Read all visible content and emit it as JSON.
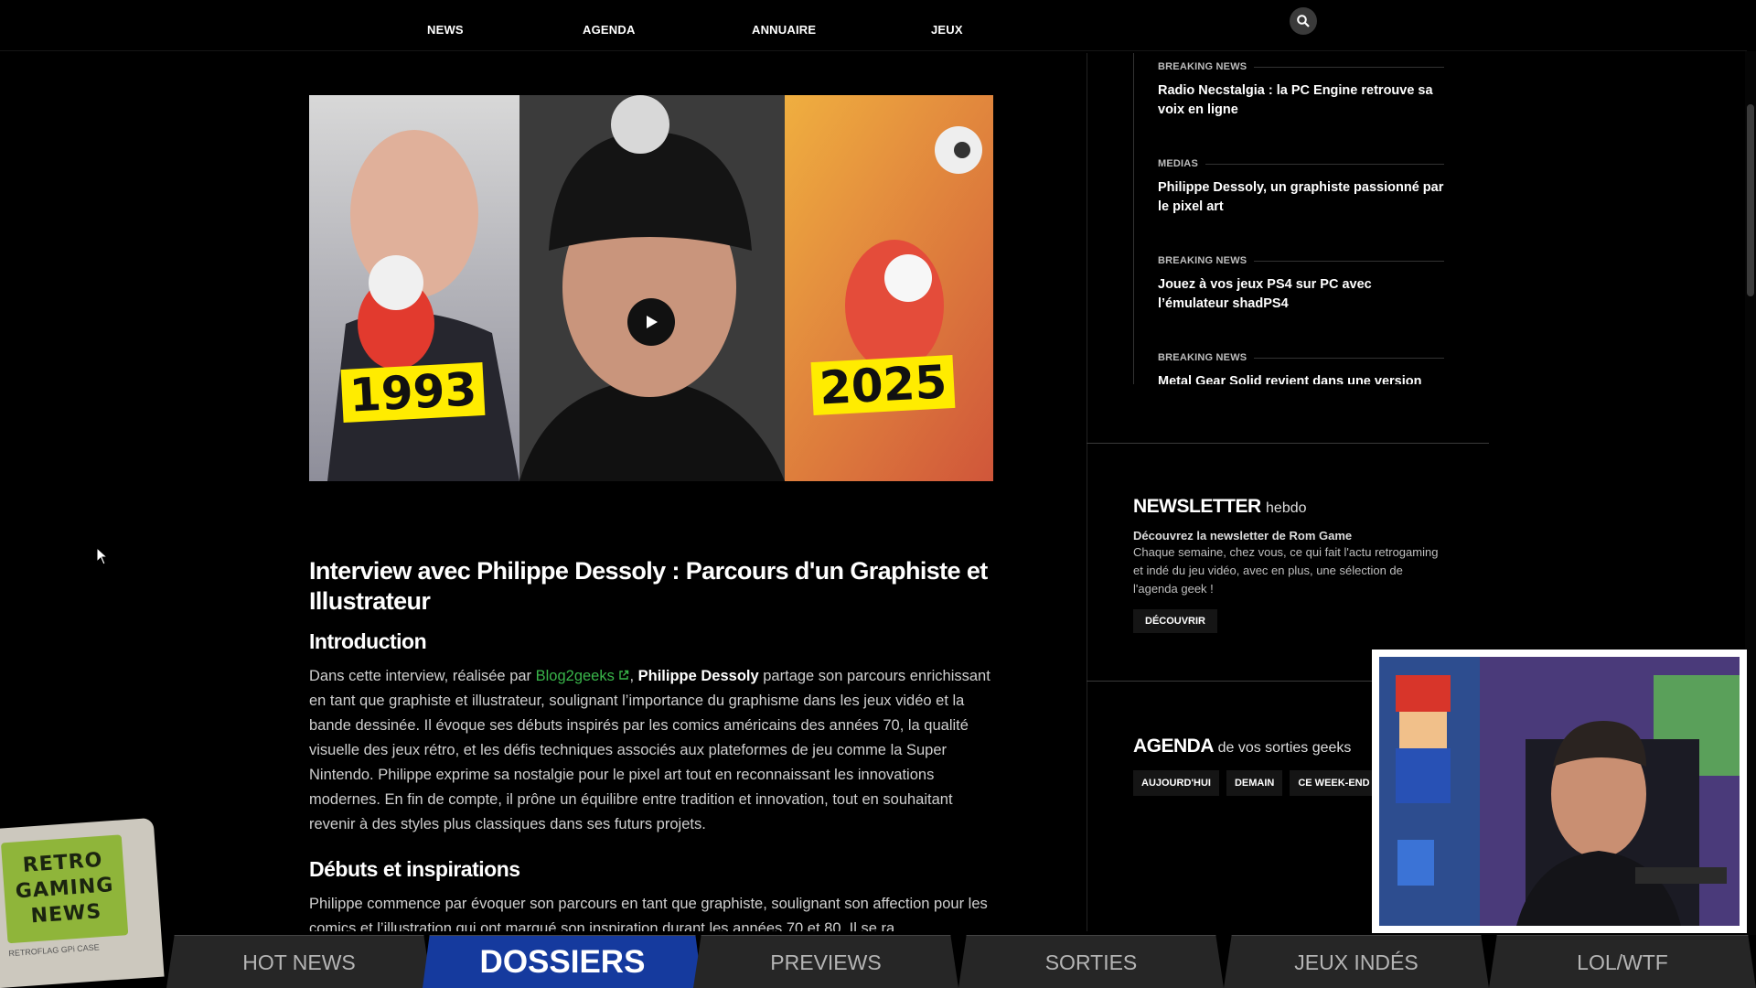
{
  "nav": {
    "items": [
      "NEWS",
      "AGENDA",
      "ANNUAIRE",
      "JEUX"
    ]
  },
  "video": {
    "year_left": "1993",
    "year_right": "2025"
  },
  "article": {
    "title": "Interview avec Philippe Dessoly : Parcours d'un Graphiste et Illustrateur",
    "intro_heading": "Introduction",
    "intro_p_prefix": "Dans cette interview, réalisée par ",
    "intro_link": "Blog2geeks",
    "intro_p_sep": ", ",
    "intro_name": "Philippe Dessoly",
    "intro_p_rest": " partage son parcours enrichissant en tant que graphiste et illustrateur, soulignant l’importance du graphisme dans les jeux vidéo et la bande dessinée. Il évoque ses débuts inspirés par les comics américains des années 70, la qualité visuelle des jeux rétro, et les défis techniques associés aux plateformes de jeu comme la Super Nintendo. Philippe exprime sa nostalgie pour le pixel art tout en reconnaissant les innovations modernes. En fin de compte, il prône un équilibre entre tradition et innovation, tout en souhaitant revenir à des styles plus classiques dans ses futurs projets.",
    "debuts_heading": "Débuts et inspirations",
    "debuts_p": "Philippe commence par évoquer son parcours en tant que graphiste, soulignant son affection pour les comics et l’illustration qui ont marqué son inspiration durant les années 70 et 80. Il se ra"
  },
  "sidebar": {
    "news": [
      {
        "category": "BREAKING NEWS",
        "title": "Radio Necstalgia : la PC Engine retrouve sa voix en ligne"
      },
      {
        "category": "MEDIAS",
        "title": "Philippe Dessoly, un graphiste passionné par le pixel art"
      },
      {
        "category": "BREAKING NEWS",
        "title": "Jouez à vos jeux PS4 sur PC avec l’émulateur shadPS4"
      },
      {
        "category": "BREAKING NEWS",
        "title": "Metal Gear Solid revient dans une version inédite"
      }
    ],
    "newsletter": {
      "title": "NEWSLETTER",
      "title_sub": "hebdo",
      "lead": "Découvrez la newsletter de Rom Game",
      "text": "Chaque semaine, chez vous, ce qui fait l'actu retrogaming et indé du jeu vidéo, avec en plus, une sélection de l'agenda geek !",
      "button": "DÉCOUVRIR"
    },
    "agenda": {
      "title": "AGENDA",
      "title_sub": "de vos sorties geeks",
      "filters": [
        "AUJOURD'HUI",
        "DEMAIN",
        "CE WEEK-END"
      ]
    }
  },
  "tabs": [
    {
      "label": "HOT NEWS"
    },
    {
      "label": "DOSSIERS",
      "active": true
    },
    {
      "label": "PREVIEWS"
    },
    {
      "label": "SORTIES"
    },
    {
      "label": "JEUX INDÉS"
    },
    {
      "label": "LOL/WTF"
    }
  ],
  "device": {
    "screen_lines": [
      "RETRO",
      "GAMING",
      "NEWS"
    ],
    "brand": "RETROFLAG GPi CASE"
  },
  "colors": {
    "accent_tab": "#153a9e",
    "link": "#39b54a",
    "year_badge": "#ffec00"
  }
}
